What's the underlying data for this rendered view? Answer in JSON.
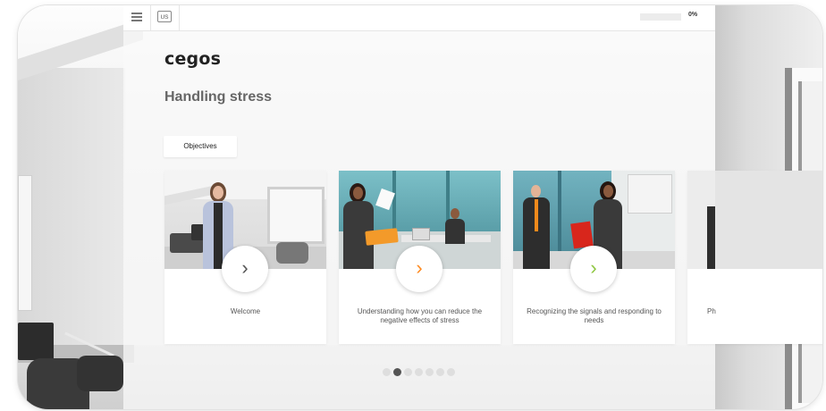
{
  "toolbar": {
    "language": "US",
    "progress": {
      "value": 0,
      "label": "0%"
    }
  },
  "brand": {
    "logo_text": "cegos"
  },
  "course": {
    "title": "Handling stress",
    "objectives_label": "Objectives"
  },
  "modules": [
    {
      "label": "Welcome"
    },
    {
      "label": "Understanding how you can reduce the negative effects of stress"
    },
    {
      "label": "Recognizing the signals and responding to needs"
    },
    {
      "label": "Ph"
    }
  ],
  "pagination": {
    "total": 6,
    "active_index": 1
  },
  "colors": {
    "accent": "#ff8a1f",
    "accent_green": "#8dc63f",
    "arrow_dark": "#555555",
    "office_teal": "#5aa7b0"
  },
  "icons": {
    "menu": "hamburger-icon",
    "play": "chevron-right-icon"
  }
}
